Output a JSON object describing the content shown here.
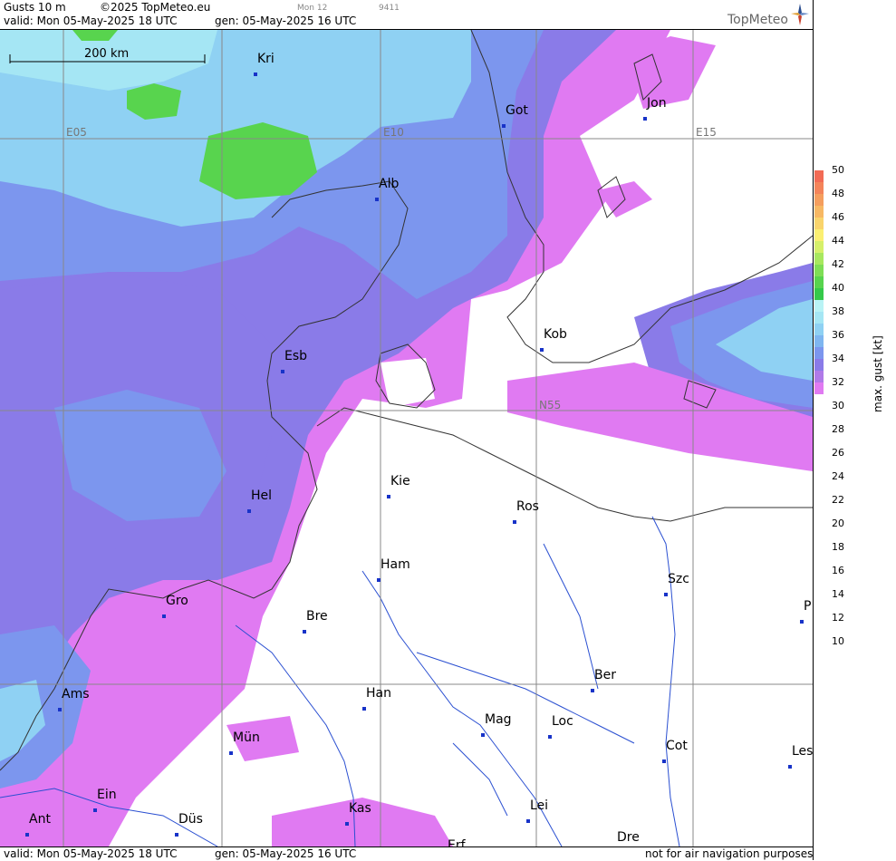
{
  "header": {
    "title": "Gusts 10 m",
    "copyright": "©2025 TopMeteo.eu",
    "valid": "valid:  Mon  05-May-2025  18 UTC",
    "gen": "gen: 05-May-2025 16 UTC",
    "small_a": "Mon 12",
    "small_b": "9411",
    "logo": "TopMeteo"
  },
  "footer": {
    "valid": "valid:  Mon  05-May-2025  18 UTC",
    "gen": "gen: 05-May-2025 16 UTC",
    "note": "not for air navigation purposes"
  },
  "scale": {
    "label": "200 km"
  },
  "grid_labels": {
    "e05": "E05",
    "e10": "E10",
    "e15": "E15",
    "n55": "N55"
  },
  "colorbar": {
    "title": "max. gust [kt]",
    "ticks": [
      "50",
      "48",
      "46",
      "44",
      "42",
      "40",
      "38",
      "36",
      "34",
      "32",
      "30",
      "28",
      "26",
      "24",
      "22",
      "20",
      "18",
      "16",
      "14",
      "12",
      "10"
    ],
    "colors": [
      "#f26b55",
      "#f4845a",
      "#f59e5e",
      "#f7b864",
      "#f9d46c",
      "#fbef72",
      "#d6f06a",
      "#a8e85f",
      "#7fde56",
      "#58d44e",
      "#35c94a",
      "#b9f3f5",
      "#a5e6f4",
      "#8fd1f3",
      "#7fb6f0",
      "#7c96ee",
      "#8a7be8",
      "#b07ae8",
      "#e07af2",
      "#ffffff"
    ]
  },
  "cities": [
    {
      "name": "Kri"
    },
    {
      "name": "Got"
    },
    {
      "name": "Jon"
    },
    {
      "name": "Alb"
    },
    {
      "name": "Esb"
    },
    {
      "name": "Kob"
    },
    {
      "name": "Kie"
    },
    {
      "name": "Ros"
    },
    {
      "name": "Hel"
    },
    {
      "name": "Ham"
    },
    {
      "name": "Szc"
    },
    {
      "name": "Gro"
    },
    {
      "name": "Bre"
    },
    {
      "name": "P"
    },
    {
      "name": "Ber"
    },
    {
      "name": "Ams"
    },
    {
      "name": "Han"
    },
    {
      "name": "Mag"
    },
    {
      "name": "Loc"
    },
    {
      "name": "Mün"
    },
    {
      "name": "Cot"
    },
    {
      "name": "Les"
    },
    {
      "name": "Ein"
    },
    {
      "name": "Kas"
    },
    {
      "name": "Lei"
    },
    {
      "name": "Ant"
    },
    {
      "name": "Düs"
    },
    {
      "name": "Dre"
    },
    {
      "name": "Erf"
    }
  ]
}
